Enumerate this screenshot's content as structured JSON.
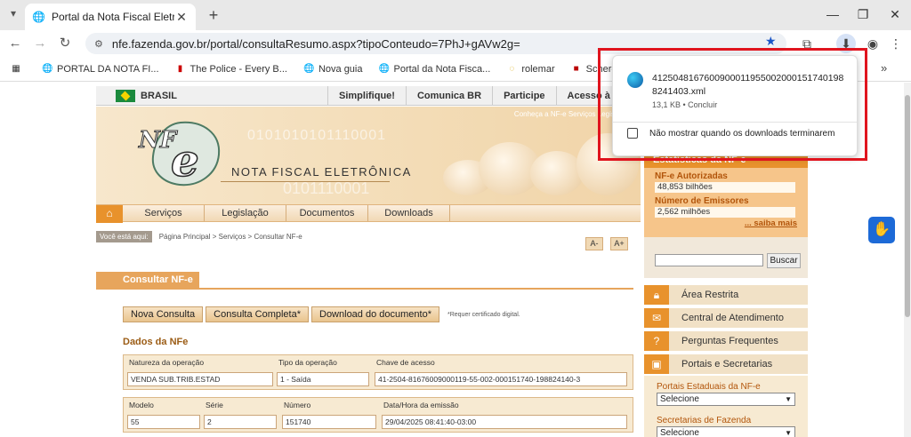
{
  "browser": {
    "tab_title": "Portal da Nota Fiscal Eletrônica",
    "url": "nfe.fazenda.gov.br/portal/consultaResumo.aspx?tipoConteudo=7PhJ+gAVw2g=",
    "bookmarks": [
      {
        "label": "PORTAL DA NOTA FI...",
        "icon": "globe-icon"
      },
      {
        "label": "The Police - Every B...",
        "icon": "music-icon"
      },
      {
        "label": "Nova guia",
        "icon": "globe-icon"
      },
      {
        "label": "Portal da Nota Fisca...",
        "icon": "globe-icon"
      },
      {
        "label": "rolemar",
        "icon": "rolemar-icon"
      },
      {
        "label": "Scherer Autopeças -...",
        "icon": "scherer-icon"
      }
    ]
  },
  "download_popup": {
    "filename": "41250481676009000119550020001517401988241403.xml",
    "meta": "13,1 KB • Concluir",
    "checkbox_label": "Não mostrar quando os downloads terminarem"
  },
  "gov_bar": {
    "country": "BRASIL",
    "links": [
      "Simplifique!",
      "Comunica BR",
      "Participe",
      "Acesso à infor"
    ]
  },
  "banner": {
    "toplinks": "Conheça a NF-e   Serviços   Legislação",
    "title": "NOTA FISCAL ELETRÔNICA",
    "bits": "0101010101110001",
    "bits2": "0101110001"
  },
  "menu": {
    "items": [
      "Serviços",
      "Legislação",
      "Documentos",
      "Downloads"
    ]
  },
  "breadcrumb": {
    "label": "Você está aqui:",
    "path": "Página Principal > Serviços > Consultar NF-e"
  },
  "font_buttons": {
    "decrease": "A-",
    "increase": "A+"
  },
  "section": {
    "title": "Consultar NF-e",
    "buttons": [
      "Nova Consulta",
      "Consulta Completa*",
      "Download do documento*"
    ],
    "note": "*Requer certificado digital."
  },
  "dados": {
    "title": "Dados da NFe",
    "row1": {
      "labels": [
        "Natureza da operação",
        "Tipo da operação",
        "Chave de acesso"
      ],
      "values": [
        "VENDA SUB.TRIB.ESTAD",
        "1 - Saída",
        "41-2504-81676009000119-55-002-000151740-198824140-3"
      ]
    },
    "row2": {
      "labels": [
        "Modelo",
        "Série",
        "Número",
        "Data/Hora da emissão"
      ],
      "values": [
        "55",
        "2",
        "151740",
        "29/04/2025 08:41:40-03:00"
      ]
    }
  },
  "stats": {
    "title": "Estatísticas da NF-e",
    "items": [
      {
        "label": "NF-e Autorizadas",
        "value": "48,853 bilhões"
      },
      {
        "label": "Número de Emissores",
        "value": "2,562 milhões"
      }
    ],
    "more": "... saiba mais"
  },
  "search": {
    "button": "Buscar"
  },
  "side_links": [
    {
      "label": "Área Restrita",
      "icon": "lock-icon"
    },
    {
      "label": "Central de Atendimento",
      "icon": "mail-icon"
    },
    {
      "label": "Perguntas Frequentes",
      "icon": "question-icon"
    },
    {
      "label": "Portais e Secretarias",
      "icon": "monitor-icon"
    }
  ],
  "selects": [
    {
      "label": "Portais Estaduais da NF-e",
      "value": "Selecione"
    },
    {
      "label": "Secretarias de Fazenda",
      "value": "Selecione"
    }
  ]
}
